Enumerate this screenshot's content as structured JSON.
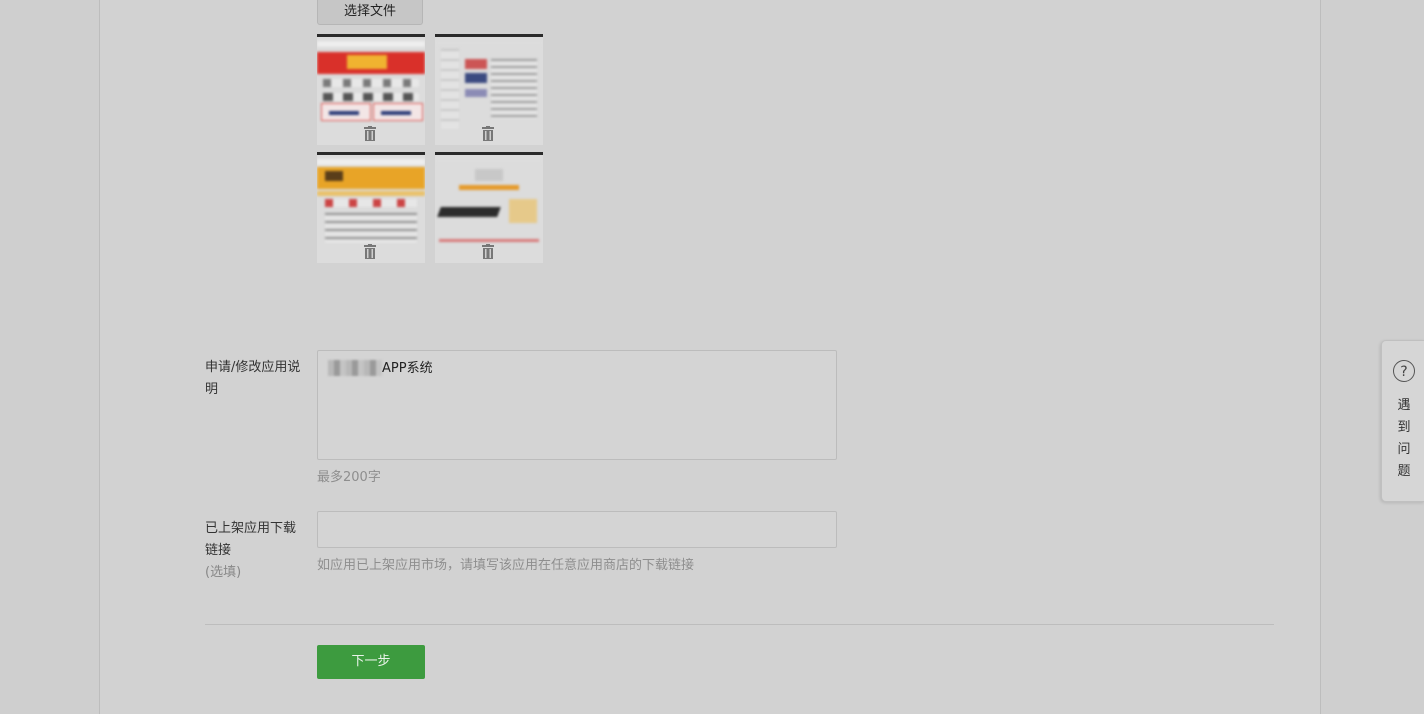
{
  "upload": {
    "choose_file_label": "选择文件",
    "thumbnails": [
      {
        "name": "screenshot-1"
      },
      {
        "name": "screenshot-2"
      },
      {
        "name": "screenshot-3"
      },
      {
        "name": "screenshot-4"
      }
    ],
    "delete_icon": "trash-icon"
  },
  "description": {
    "label": "申请/修改应用说明",
    "value": "APP系统",
    "hint": "最多200字"
  },
  "download_link": {
    "label": "已上架应用下载链接",
    "optional": "(选填)",
    "value": "",
    "hint": "如应用已上架应用市场，请填写该应用在任意应用商店的下载链接"
  },
  "actions": {
    "next_label": "下一步"
  },
  "help_widget": {
    "icon": "question-icon",
    "icon_glyph": "?",
    "label": "遇到问题"
  },
  "colors": {
    "primary_button": "#3d9b3f",
    "overlay": "#cfcfcf"
  }
}
